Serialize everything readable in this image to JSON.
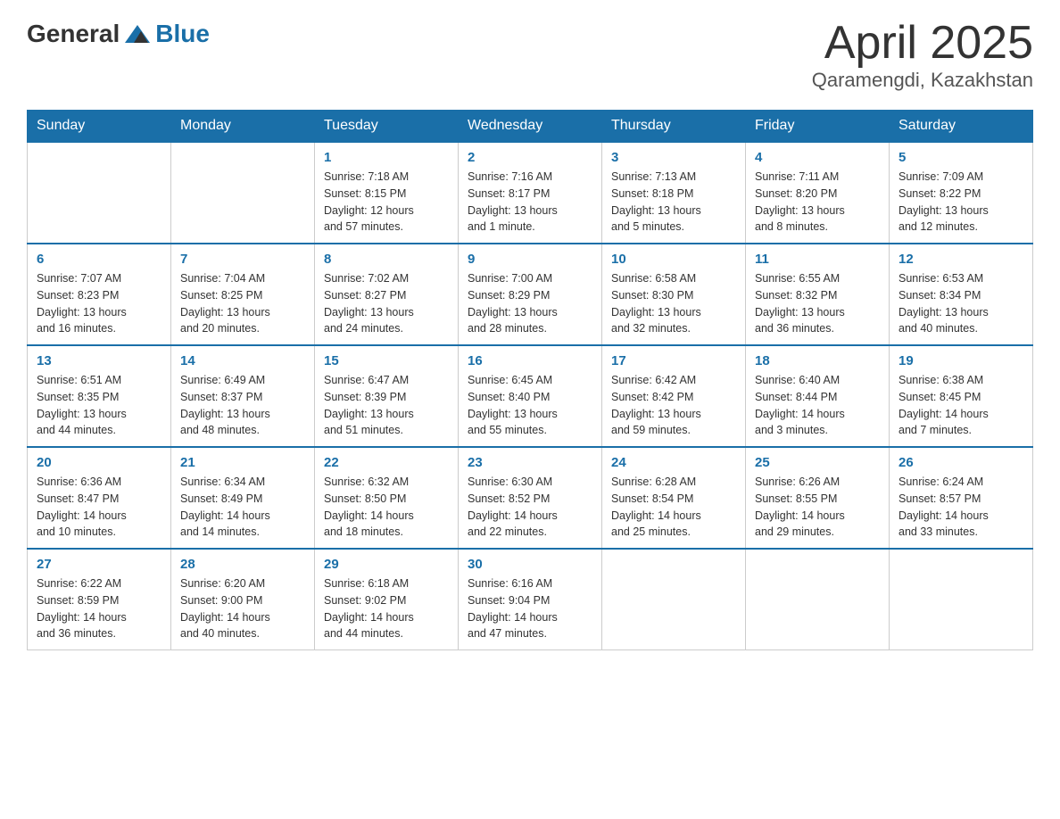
{
  "header": {
    "logo": {
      "general": "General",
      "blue": "Blue"
    },
    "title": "April 2025",
    "location": "Qaramengdi, Kazakhstan"
  },
  "weekdays": [
    "Sunday",
    "Monday",
    "Tuesday",
    "Wednesday",
    "Thursday",
    "Friday",
    "Saturday"
  ],
  "weeks": [
    [
      {
        "day": "",
        "info": ""
      },
      {
        "day": "",
        "info": ""
      },
      {
        "day": "1",
        "info": "Sunrise: 7:18 AM\nSunset: 8:15 PM\nDaylight: 12 hours\nand 57 minutes."
      },
      {
        "day": "2",
        "info": "Sunrise: 7:16 AM\nSunset: 8:17 PM\nDaylight: 13 hours\nand 1 minute."
      },
      {
        "day": "3",
        "info": "Sunrise: 7:13 AM\nSunset: 8:18 PM\nDaylight: 13 hours\nand 5 minutes."
      },
      {
        "day": "4",
        "info": "Sunrise: 7:11 AM\nSunset: 8:20 PM\nDaylight: 13 hours\nand 8 minutes."
      },
      {
        "day": "5",
        "info": "Sunrise: 7:09 AM\nSunset: 8:22 PM\nDaylight: 13 hours\nand 12 minutes."
      }
    ],
    [
      {
        "day": "6",
        "info": "Sunrise: 7:07 AM\nSunset: 8:23 PM\nDaylight: 13 hours\nand 16 minutes."
      },
      {
        "day": "7",
        "info": "Sunrise: 7:04 AM\nSunset: 8:25 PM\nDaylight: 13 hours\nand 20 minutes."
      },
      {
        "day": "8",
        "info": "Sunrise: 7:02 AM\nSunset: 8:27 PM\nDaylight: 13 hours\nand 24 minutes."
      },
      {
        "day": "9",
        "info": "Sunrise: 7:00 AM\nSunset: 8:29 PM\nDaylight: 13 hours\nand 28 minutes."
      },
      {
        "day": "10",
        "info": "Sunrise: 6:58 AM\nSunset: 8:30 PM\nDaylight: 13 hours\nand 32 minutes."
      },
      {
        "day": "11",
        "info": "Sunrise: 6:55 AM\nSunset: 8:32 PM\nDaylight: 13 hours\nand 36 minutes."
      },
      {
        "day": "12",
        "info": "Sunrise: 6:53 AM\nSunset: 8:34 PM\nDaylight: 13 hours\nand 40 minutes."
      }
    ],
    [
      {
        "day": "13",
        "info": "Sunrise: 6:51 AM\nSunset: 8:35 PM\nDaylight: 13 hours\nand 44 minutes."
      },
      {
        "day": "14",
        "info": "Sunrise: 6:49 AM\nSunset: 8:37 PM\nDaylight: 13 hours\nand 48 minutes."
      },
      {
        "day": "15",
        "info": "Sunrise: 6:47 AM\nSunset: 8:39 PM\nDaylight: 13 hours\nand 51 minutes."
      },
      {
        "day": "16",
        "info": "Sunrise: 6:45 AM\nSunset: 8:40 PM\nDaylight: 13 hours\nand 55 minutes."
      },
      {
        "day": "17",
        "info": "Sunrise: 6:42 AM\nSunset: 8:42 PM\nDaylight: 13 hours\nand 59 minutes."
      },
      {
        "day": "18",
        "info": "Sunrise: 6:40 AM\nSunset: 8:44 PM\nDaylight: 14 hours\nand 3 minutes."
      },
      {
        "day": "19",
        "info": "Sunrise: 6:38 AM\nSunset: 8:45 PM\nDaylight: 14 hours\nand 7 minutes."
      }
    ],
    [
      {
        "day": "20",
        "info": "Sunrise: 6:36 AM\nSunset: 8:47 PM\nDaylight: 14 hours\nand 10 minutes."
      },
      {
        "day": "21",
        "info": "Sunrise: 6:34 AM\nSunset: 8:49 PM\nDaylight: 14 hours\nand 14 minutes."
      },
      {
        "day": "22",
        "info": "Sunrise: 6:32 AM\nSunset: 8:50 PM\nDaylight: 14 hours\nand 18 minutes."
      },
      {
        "day": "23",
        "info": "Sunrise: 6:30 AM\nSunset: 8:52 PM\nDaylight: 14 hours\nand 22 minutes."
      },
      {
        "day": "24",
        "info": "Sunrise: 6:28 AM\nSunset: 8:54 PM\nDaylight: 14 hours\nand 25 minutes."
      },
      {
        "day": "25",
        "info": "Sunrise: 6:26 AM\nSunset: 8:55 PM\nDaylight: 14 hours\nand 29 minutes."
      },
      {
        "day": "26",
        "info": "Sunrise: 6:24 AM\nSunset: 8:57 PM\nDaylight: 14 hours\nand 33 minutes."
      }
    ],
    [
      {
        "day": "27",
        "info": "Sunrise: 6:22 AM\nSunset: 8:59 PM\nDaylight: 14 hours\nand 36 minutes."
      },
      {
        "day": "28",
        "info": "Sunrise: 6:20 AM\nSunset: 9:00 PM\nDaylight: 14 hours\nand 40 minutes."
      },
      {
        "day": "29",
        "info": "Sunrise: 6:18 AM\nSunset: 9:02 PM\nDaylight: 14 hours\nand 44 minutes."
      },
      {
        "day": "30",
        "info": "Sunrise: 6:16 AM\nSunset: 9:04 PM\nDaylight: 14 hours\nand 47 minutes."
      },
      {
        "day": "",
        "info": ""
      },
      {
        "day": "",
        "info": ""
      },
      {
        "day": "",
        "info": ""
      }
    ]
  ]
}
